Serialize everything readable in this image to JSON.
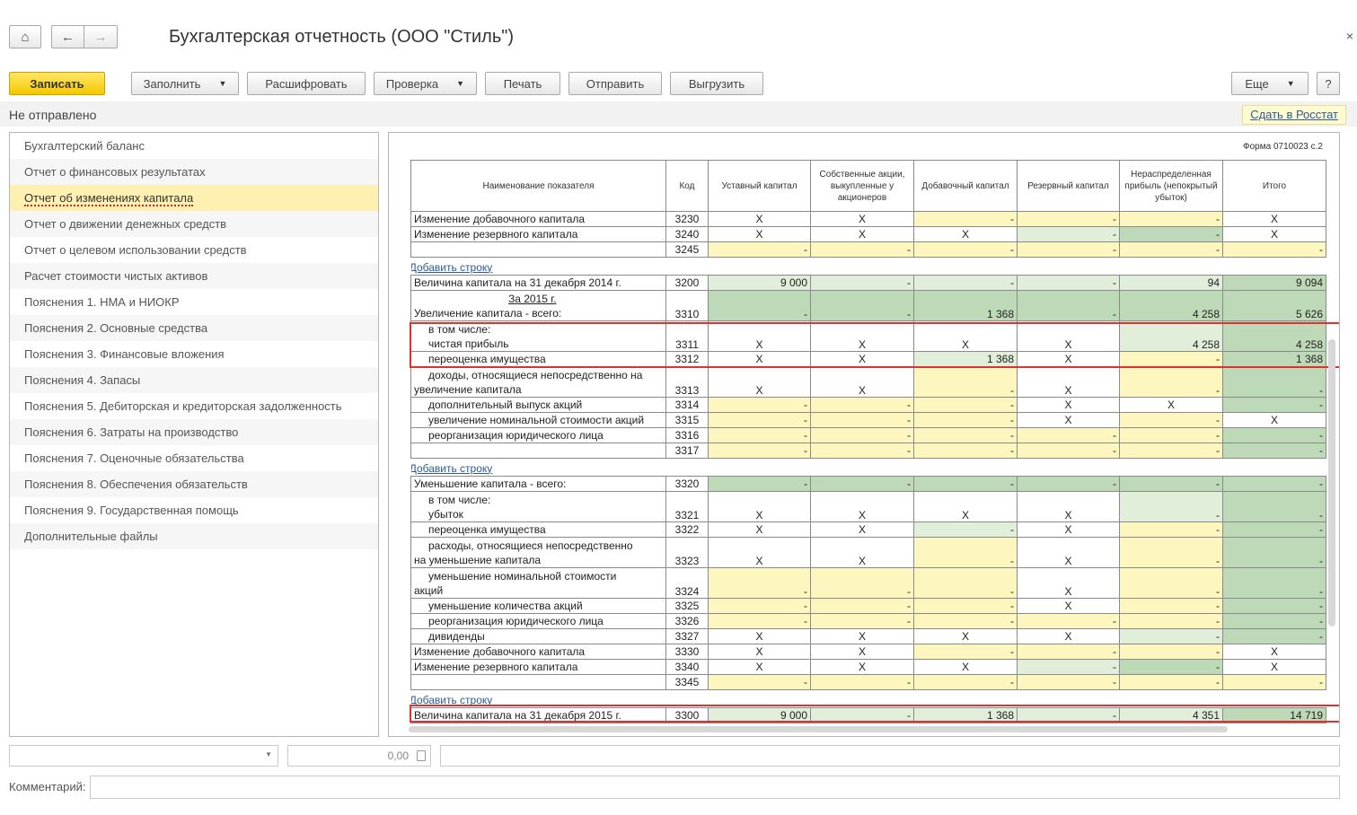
{
  "window": {
    "title": "Бухгалтерская отчетность (ООО \"Стиль\")",
    "close_glyph": "×",
    "home_glyph": "⌂",
    "back_glyph": "←",
    "forward_glyph": "→"
  },
  "toolbar": {
    "save": "Записать",
    "fill": "Заполнить",
    "decode": "Расшифровать",
    "check": "Проверка",
    "print": "Печать",
    "send": "Отправить",
    "export": "Выгрузить",
    "more": "Еще",
    "help": "?",
    "dropdown_glyph": "▼"
  },
  "status": {
    "text": "Не отправлено",
    "rosstat_link": "Сдать в Росстат"
  },
  "sidebar": {
    "items": [
      "Бухгалтерский баланс",
      "Отчет о финансовых результатах",
      "Отчет об изменениях капитала",
      "Отчет о движении денежных средств",
      "Отчет о целевом использовании средств",
      "Расчет стоимости чистых активов",
      "Пояснения 1. НМА и НИОКР",
      "Пояснения 2. Основные средства",
      "Пояснения 3. Финансовые вложения",
      "Пояснения 4. Запасы",
      "Пояснения 5. Дебиторская и кредиторская задолженность",
      "Пояснения 6. Затраты на производство",
      "Пояснения 7. Оценочные обязательства",
      "Пояснения 8. Обеспечения обязательств",
      "Пояснения 9. Государственная помощь",
      "Дополнительные файлы"
    ],
    "active_index": 2
  },
  "report": {
    "form_label": "Форма 0710023 с.2",
    "add_row_label": "Добавить строку",
    "add_row_glyph": "+",
    "headers": [
      "Наименование показателя",
      "Код",
      "Уставный капитал",
      "Собственные акции, выкупленные у акционеров",
      "Добавочный капитал",
      "Резервный капитал",
      "Нераспределенная прибыль (непокрытый убыток)",
      "Итого"
    ],
    "rows": [
      {
        "type": "row",
        "name": "Изменение добавочного капитала",
        "code": "3230",
        "cells": [
          [
            "X",
            "x"
          ],
          [
            "X",
            "x"
          ],
          [
            "-",
            "y"
          ],
          [
            "-",
            "y"
          ],
          [
            "-",
            "y"
          ],
          [
            "X",
            "x"
          ]
        ]
      },
      {
        "type": "row",
        "name": "Изменение резервного капитала",
        "code": "3240",
        "cells": [
          [
            "X",
            "x"
          ],
          [
            "X",
            "x"
          ],
          [
            "X",
            "x"
          ],
          [
            "-",
            "lg"
          ],
          [
            "-",
            "g"
          ],
          [
            "X",
            "x"
          ]
        ]
      },
      {
        "type": "row",
        "name": "",
        "code": "3245",
        "cells": [
          [
            "-",
            "y"
          ],
          [
            "-",
            "y"
          ],
          [
            "-",
            "y"
          ],
          [
            "-",
            "y"
          ],
          [
            "-",
            "y"
          ],
          [
            "-",
            "y"
          ]
        ]
      },
      {
        "type": "add"
      },
      {
        "type": "row",
        "name": "Величина капитала на 31 декабря 2014 г.",
        "code": "3200",
        "cells": [
          [
            "9 000",
            "lg"
          ],
          [
            "-",
            "lg"
          ],
          [
            "-",
            "lg"
          ],
          [
            "-",
            "lg"
          ],
          [
            "94",
            "lg"
          ],
          [
            "9 094",
            "g"
          ]
        ]
      },
      {
        "type": "tall",
        "name": "За 2015 г.",
        "name2": "Увеличение капитала - всего:",
        "code": "3310",
        "cells": [
          [
            "-",
            "g"
          ],
          [
            "-",
            "g"
          ],
          [
            "1 368",
            "g"
          ],
          [
            "-",
            "g"
          ],
          [
            "4 258",
            "g"
          ],
          [
            "5 626",
            "g"
          ]
        ]
      },
      {
        "type": "tall",
        "name": "в том числе:",
        "name2": "чистая прибыль",
        "sub": true,
        "code": "3311",
        "cells": [
          [
            "X",
            "x"
          ],
          [
            "X",
            "x"
          ],
          [
            "X",
            "x"
          ],
          [
            "X",
            "x"
          ],
          [
            "4 258",
            "lg"
          ],
          [
            "4 258",
            "g"
          ]
        ]
      },
      {
        "type": "row",
        "name": "переоценка имущества",
        "sub": true,
        "code": "3312",
        "cells": [
          [
            "X",
            "x"
          ],
          [
            "X",
            "x"
          ],
          [
            "1 368",
            "lg"
          ],
          [
            "X",
            "x"
          ],
          [
            "-",
            "y"
          ],
          [
            "1 368",
            "g"
          ]
        ]
      },
      {
        "type": "tall",
        "name": "доходы, относящиеся непосредственно на",
        "name2": "увеличение капитала",
        "code": "3313",
        "cells": [
          [
            "X",
            "x"
          ],
          [
            "X",
            "x"
          ],
          [
            "-",
            "y"
          ],
          [
            "X",
            "x"
          ],
          [
            "-",
            "y"
          ],
          [
            "-",
            "g"
          ]
        ]
      },
      {
        "type": "row",
        "name": "дополнительный выпуск акций",
        "sub": true,
        "code": "3314",
        "cells": [
          [
            "-",
            "y"
          ],
          [
            "-",
            "y"
          ],
          [
            "-",
            "y"
          ],
          [
            "X",
            "x"
          ],
          [
            "X",
            "x"
          ],
          [
            "-",
            "g"
          ]
        ]
      },
      {
        "type": "row",
        "name": "увеличение номинальной стоимости акций",
        "sub": true,
        "code": "3315",
        "cells": [
          [
            "-",
            "y"
          ],
          [
            "-",
            "y"
          ],
          [
            "-",
            "y"
          ],
          [
            "X",
            "x"
          ],
          [
            "-",
            "y"
          ],
          [
            "X",
            "x"
          ]
        ]
      },
      {
        "type": "row",
        "name": "реорганизация юридического лица",
        "sub": true,
        "code": "3316",
        "cells": [
          [
            "-",
            "y"
          ],
          [
            "-",
            "y"
          ],
          [
            "-",
            "y"
          ],
          [
            "-",
            "y"
          ],
          [
            "-",
            "y"
          ],
          [
            "-",
            "g"
          ]
        ]
      },
      {
        "type": "row",
        "name": "",
        "code": "3317",
        "cells": [
          [
            "-",
            "y"
          ],
          [
            "-",
            "y"
          ],
          [
            "-",
            "y"
          ],
          [
            "-",
            "y"
          ],
          [
            "-",
            "y"
          ],
          [
            "-",
            "g"
          ]
        ]
      },
      {
        "type": "add"
      },
      {
        "type": "row",
        "name": "Уменьшение капитала - всего:",
        "code": "3320",
        "cells": [
          [
            "-",
            "g"
          ],
          [
            "-",
            "g"
          ],
          [
            "-",
            "g"
          ],
          [
            "-",
            "g"
          ],
          [
            "-",
            "g"
          ],
          [
            "-",
            "g"
          ]
        ]
      },
      {
        "type": "tall",
        "name": "в том числе:",
        "name2": "убыток",
        "sub": true,
        "code": "3321",
        "cells": [
          [
            "X",
            "x"
          ],
          [
            "X",
            "x"
          ],
          [
            "X",
            "x"
          ],
          [
            "X",
            "x"
          ],
          [
            "-",
            "lg"
          ],
          [
            "-",
            "g"
          ]
        ]
      },
      {
        "type": "row",
        "name": "переоценка имущества",
        "sub": true,
        "code": "3322",
        "cells": [
          [
            "X",
            "x"
          ],
          [
            "X",
            "x"
          ],
          [
            "-",
            "lg"
          ],
          [
            "X",
            "x"
          ],
          [
            "-",
            "y"
          ],
          [
            "-",
            "g"
          ]
        ]
      },
      {
        "type": "tall",
        "name": "расходы, относящиеся непосредственно",
        "name2": "на уменьшение капитала",
        "code": "3323",
        "cells": [
          [
            "X",
            "x"
          ],
          [
            "X",
            "x"
          ],
          [
            "-",
            "y"
          ],
          [
            "X",
            "x"
          ],
          [
            "-",
            "y"
          ],
          [
            "-",
            "g"
          ]
        ]
      },
      {
        "type": "tall",
        "name": "уменьшение номинальной стоимости",
        "name2": "акций",
        "code": "3324",
        "cells": [
          [
            "-",
            "y"
          ],
          [
            "-",
            "y"
          ],
          [
            "-",
            "y"
          ],
          [
            "X",
            "x"
          ],
          [
            "-",
            "y"
          ],
          [
            "-",
            "g"
          ]
        ]
      },
      {
        "type": "row",
        "name": "уменьшение количества акций",
        "sub": true,
        "code": "3325",
        "cells": [
          [
            "-",
            "y"
          ],
          [
            "-",
            "y"
          ],
          [
            "-",
            "y"
          ],
          [
            "X",
            "x"
          ],
          [
            "-",
            "y"
          ],
          [
            "-",
            "g"
          ]
        ]
      },
      {
        "type": "row",
        "name": "реорганизация юридического лица",
        "sub": true,
        "code": "3326",
        "cells": [
          [
            "-",
            "y"
          ],
          [
            "-",
            "y"
          ],
          [
            "-",
            "y"
          ],
          [
            "-",
            "y"
          ],
          [
            "-",
            "y"
          ],
          [
            "-",
            "g"
          ]
        ]
      },
      {
        "type": "row",
        "name": "дивиденды",
        "sub": true,
        "code": "3327",
        "cells": [
          [
            "X",
            "x"
          ],
          [
            "X",
            "x"
          ],
          [
            "X",
            "x"
          ],
          [
            "X",
            "x"
          ],
          [
            "-",
            "lg"
          ],
          [
            "-",
            "g"
          ]
        ]
      },
      {
        "type": "row",
        "name": "Изменение добавочного капитала",
        "code": "3330",
        "cells": [
          [
            "X",
            "x"
          ],
          [
            "X",
            "x"
          ],
          [
            "-",
            "y"
          ],
          [
            "-",
            "y"
          ],
          [
            "-",
            "y"
          ],
          [
            "X",
            "x"
          ]
        ]
      },
      {
        "type": "row",
        "name": "Изменение резервного капитала",
        "code": "3340",
        "cells": [
          [
            "X",
            "x"
          ],
          [
            "X",
            "x"
          ],
          [
            "X",
            "x"
          ],
          [
            "-",
            "lg"
          ],
          [
            "-",
            "g"
          ],
          [
            "X",
            "x"
          ]
        ]
      },
      {
        "type": "row",
        "name": "",
        "code": "3345",
        "cells": [
          [
            "-",
            "y"
          ],
          [
            "-",
            "y"
          ],
          [
            "-",
            "y"
          ],
          [
            "-",
            "y"
          ],
          [
            "-",
            "y"
          ],
          [
            "-",
            "y"
          ]
        ]
      },
      {
        "type": "add"
      },
      {
        "type": "row",
        "name": "Величина капитала на 31 декабря 2015 г.",
        "code": "3300",
        "cells": [
          [
            "9 000",
            "lg"
          ],
          [
            "-",
            "lg"
          ],
          [
            "1 368",
            "lg"
          ],
          [
            "-",
            "lg"
          ],
          [
            "4 351",
            "lg"
          ],
          [
            "14 719",
            "g"
          ]
        ]
      }
    ]
  },
  "footer": {
    "sum_value": "0,00",
    "comment_label": "Комментарий:"
  }
}
